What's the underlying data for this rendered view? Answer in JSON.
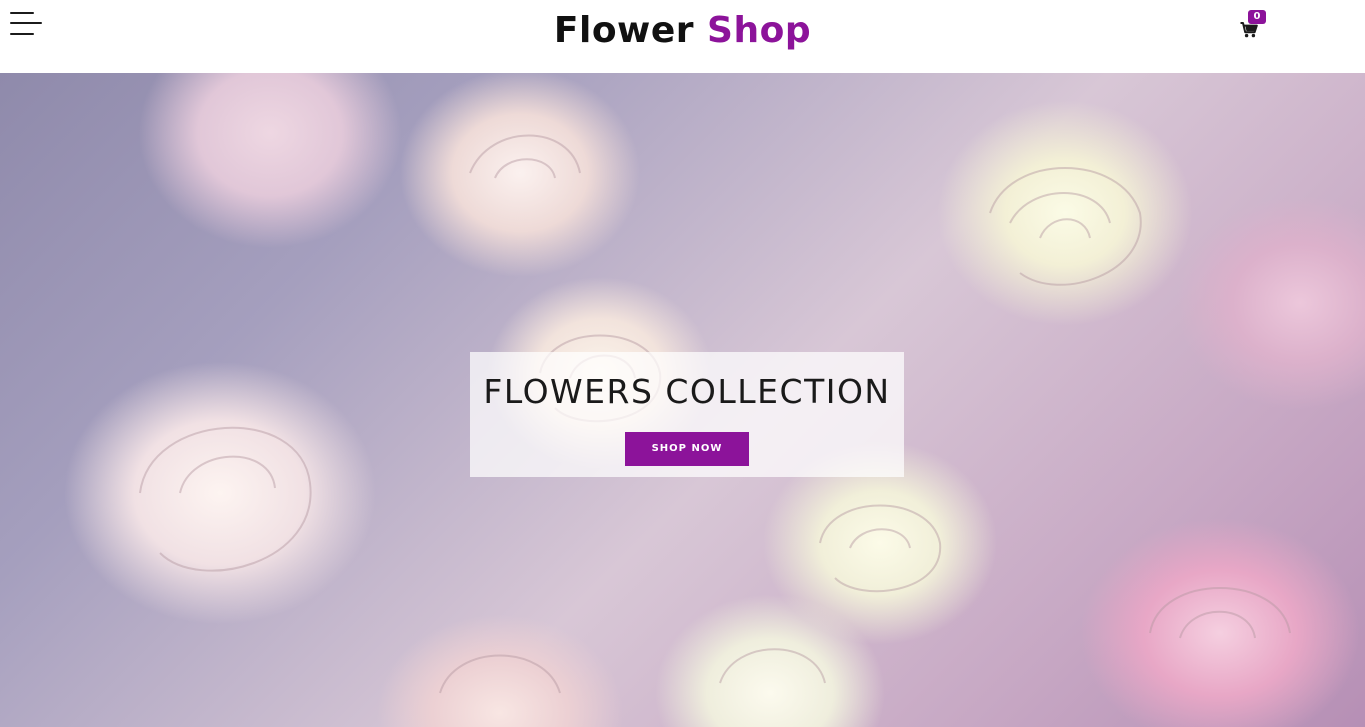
{
  "header": {
    "logo_word1": "Flower",
    "logo_word2": "Shop",
    "cart_count": "0",
    "menu_icon": "hamburger-menu-icon",
    "cart_icon": "shopping-cart-icon"
  },
  "hero": {
    "title": "FLOWERS COLLECTION",
    "button_label": "SHOP NOW"
  },
  "colors": {
    "brand": "#8c139a",
    "text_dark": "#111111",
    "header_bg": "#ffffff"
  }
}
